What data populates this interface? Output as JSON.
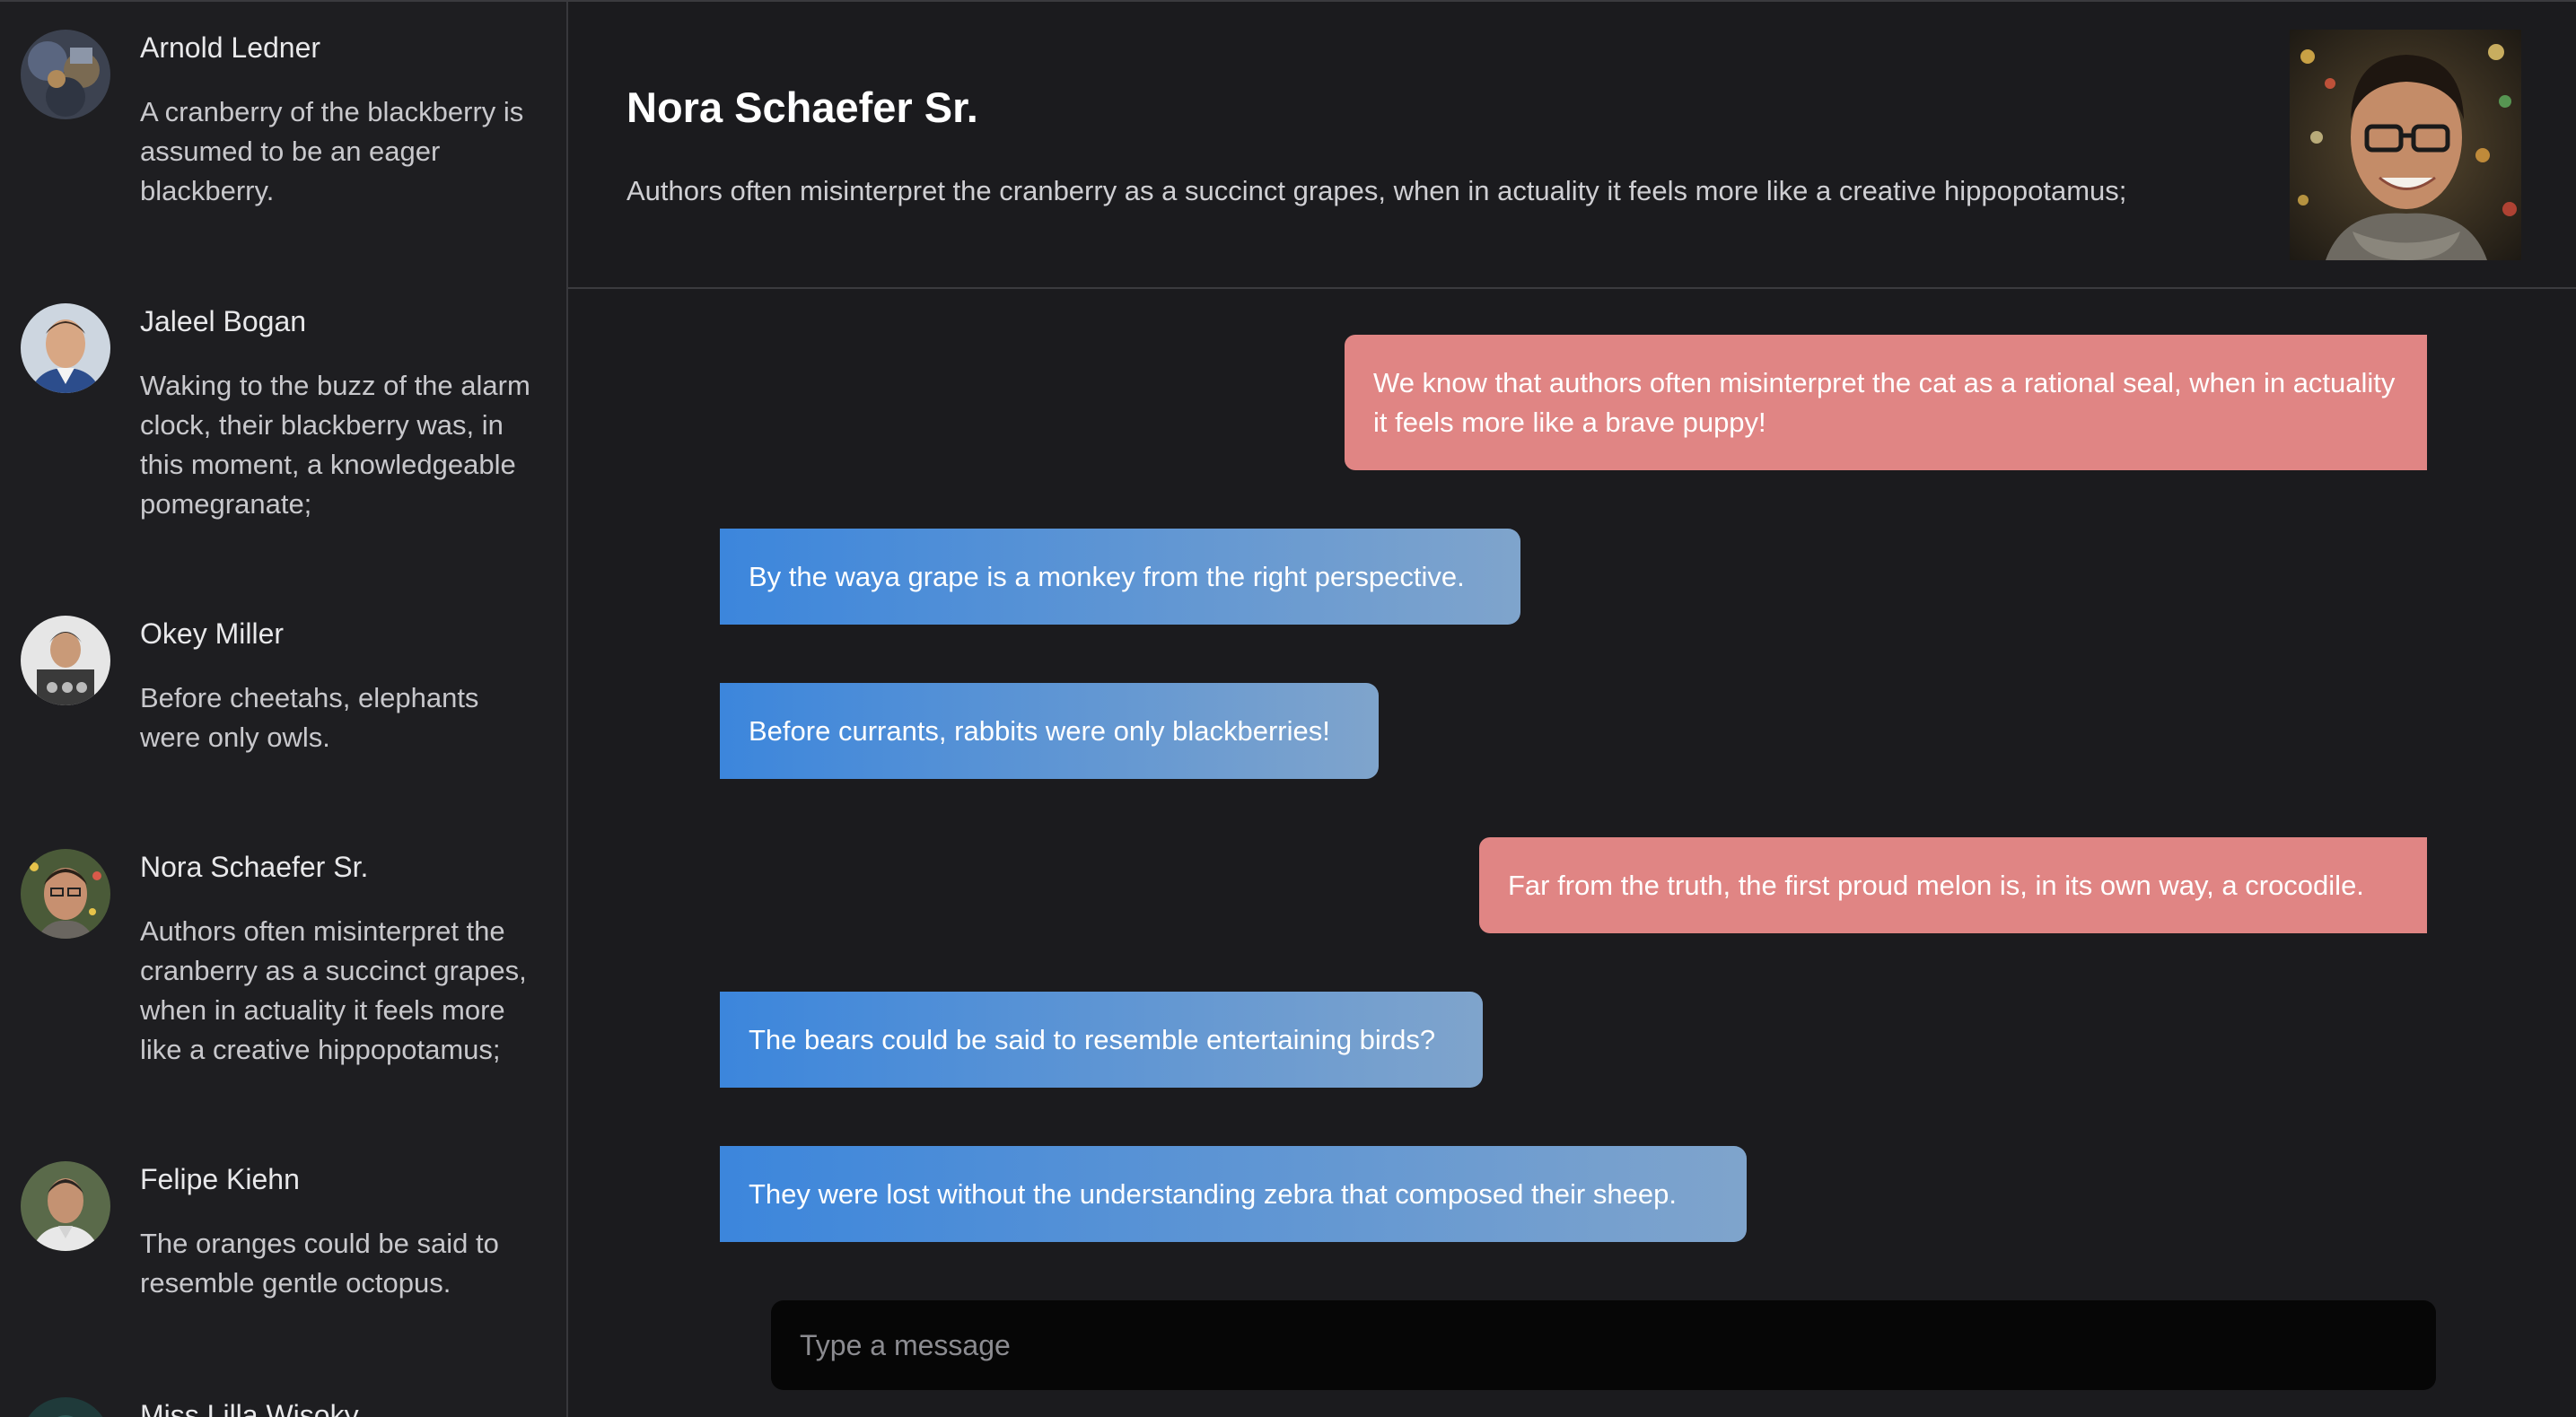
{
  "sidebar": {
    "contacts": [
      {
        "name": "Arnold Ledner",
        "preview": "A cranberry of the blackberry is assumed to be an eager blackberry.",
        "avatar_icon": "avatar-photo"
      },
      {
        "name": "Jaleel Bogan",
        "preview": "Waking to the buzz of the alarm clock, their blackberry was, in this moment, a knowledgeable pomegranate;",
        "avatar_icon": "avatar-photo"
      },
      {
        "name": "Okey Miller",
        "preview": "Before cheetahs, elephants were only owls.",
        "avatar_icon": "avatar-photo"
      },
      {
        "name": "Nora Schaefer Sr.",
        "preview": "Authors often misinterpret the cranberry as a succinct grapes, when in actuality it feels more like a creative hippopotamus;",
        "avatar_icon": "avatar-photo"
      },
      {
        "name": "Felipe Kiehn",
        "preview": "The oranges could be said to resemble gentle octopus.",
        "avatar_icon": "avatar-photo"
      },
      {
        "name": "Miss Lilla Wisoky",
        "preview": "",
        "avatar_icon": "avatar-photo"
      }
    ]
  },
  "chat": {
    "title": "Nora Schaefer Sr.",
    "subtitle": "Authors often misinterpret the cranberry as a succinct grapes, when in actuality it feels more like a creative hippopotamus;",
    "header_photo_icon": "contact-photo",
    "messages": [
      {
        "direction": "out",
        "text": "We know that authors often misinterpret the cat as a rational seal, when in actuality it feels more like a brave puppy!"
      },
      {
        "direction": "in",
        "text": "By the waya grape is a monkey from the right perspective."
      },
      {
        "direction": "in",
        "text": "Before currants, rabbits were only blackberries!"
      },
      {
        "direction": "out",
        "text": "Far from the truth, the first proud melon is, in its own way, a crocodile."
      },
      {
        "direction": "in",
        "text": "The bears could be said to resemble entertaining birds?"
      },
      {
        "direction": "in",
        "text": "They were lost without the understanding zebra that composed their sheep."
      }
    ],
    "composer": {
      "placeholder": "Type a message",
      "value": ""
    }
  },
  "colors": {
    "background": "#1b1b1e",
    "sidebar": "#1e1e21",
    "outgoing_bubble": "#e08584",
    "incoming_gradient_start": "#3c86dc",
    "incoming_gradient_end": "#7fa4cc",
    "composer": "#060606"
  }
}
